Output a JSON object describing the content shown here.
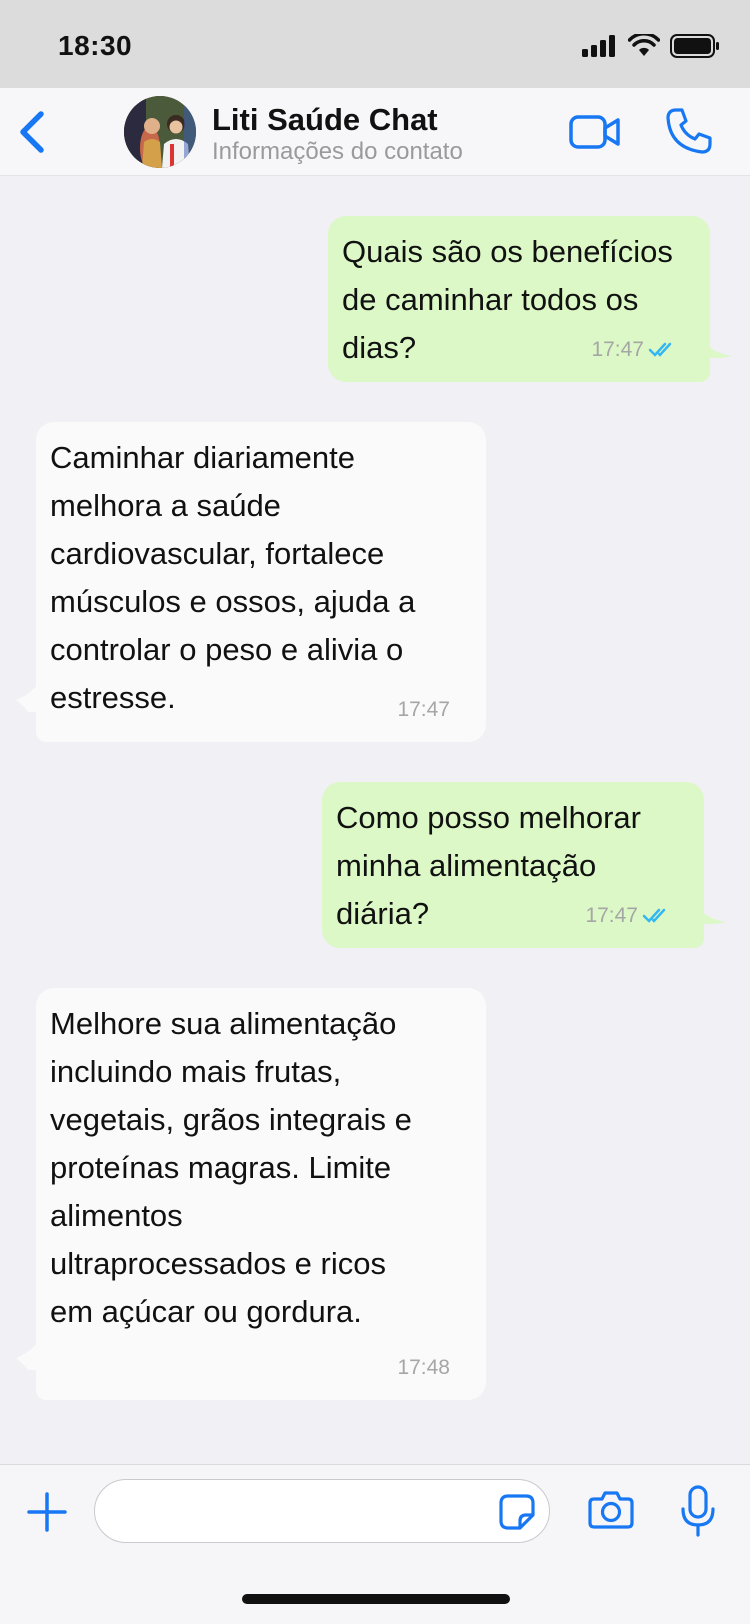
{
  "status_bar": {
    "time": "18:30",
    "icons": [
      "signal-icon",
      "wifi-icon",
      "battery-icon"
    ]
  },
  "header": {
    "back_icon": "chevron-left-icon",
    "contact_name": "Liti Saúde Chat",
    "contact_subtitle": "Informações do contato",
    "video_icon": "video-camera-icon",
    "phone_icon": "phone-icon"
  },
  "messages": [
    {
      "direction": "sent",
      "text": "Quais são os benefícios\nde caminhar todos os\ndias?",
      "time": "17:47",
      "status": "read"
    },
    {
      "direction": "received",
      "text": "Caminhar diariamente\nmelhora a saúde\ncardiovascular, fortalece\nmúsculos e ossos, ajuda a\ncontrolar o peso e alivia o\nestresse.",
      "time": "17:47"
    },
    {
      "direction": "sent",
      "text": "Como posso melhorar\nminha alimentação\ndiária?",
      "time": "17:47",
      "status": "read"
    },
    {
      "direction": "received",
      "text": "Melhore sua alimentação\nincluindo mais frutas,\nvegetais, grãos integrais e\nproteínas magras. Limite\nalimentos\nultraprocessados e ricos\nem açúcar ou gordura.",
      "time": "17:48"
    }
  ],
  "input_bar": {
    "placeholder": "",
    "icons": [
      "plus-icon",
      "sticker-icon",
      "camera-icon",
      "microphone-icon"
    ]
  },
  "colors": {
    "accent": "#1877F2",
    "sent_bubble": "#DCF8C6",
    "received_bubble": "#FAFAFA",
    "chat_background": "#F0F0F5",
    "read_ticks": "#34B7F1"
  }
}
